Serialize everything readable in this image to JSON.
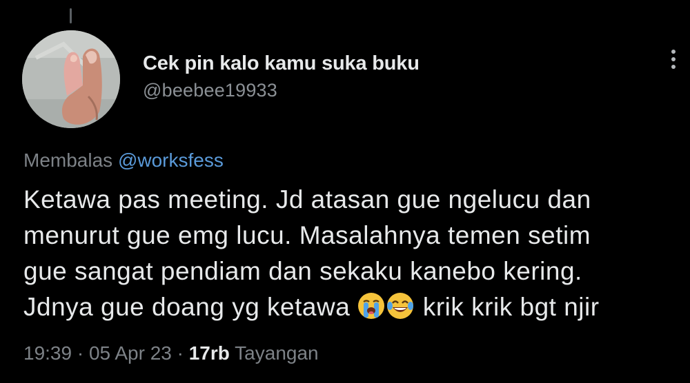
{
  "tweet": {
    "author": {
      "display_name": "Cek pin kalo kamu suka buku",
      "handle": "@beebee19933"
    },
    "reply": {
      "prefix": "Membalas",
      "mention": "@worksfess"
    },
    "text_lines": [
      "Ketawa pas meeting. Jd atasan gue ngelucu dan",
      "menurut gue emg lucu. Masalahnya temen setim",
      "gue sangat pendiam dan sekaku kanebo kering.",
      "Jdnya gue doang yg ketawa",
      "krik krik bgt njir"
    ],
    "emojis": [
      "loudly-crying-face",
      "face-with-tears-of-joy"
    ],
    "meta": {
      "time": "19:39",
      "separator": " · ",
      "date": "05 Apr 23",
      "views_count": "17rb",
      "views_label": "Tayangan"
    }
  },
  "icons": {
    "more": "vertical-ellipsis-icon"
  },
  "colors": {
    "background": "#000000",
    "text_primary": "#e7e9ea",
    "text_secondary": "#7d8287",
    "link": "#5a9ad9"
  }
}
